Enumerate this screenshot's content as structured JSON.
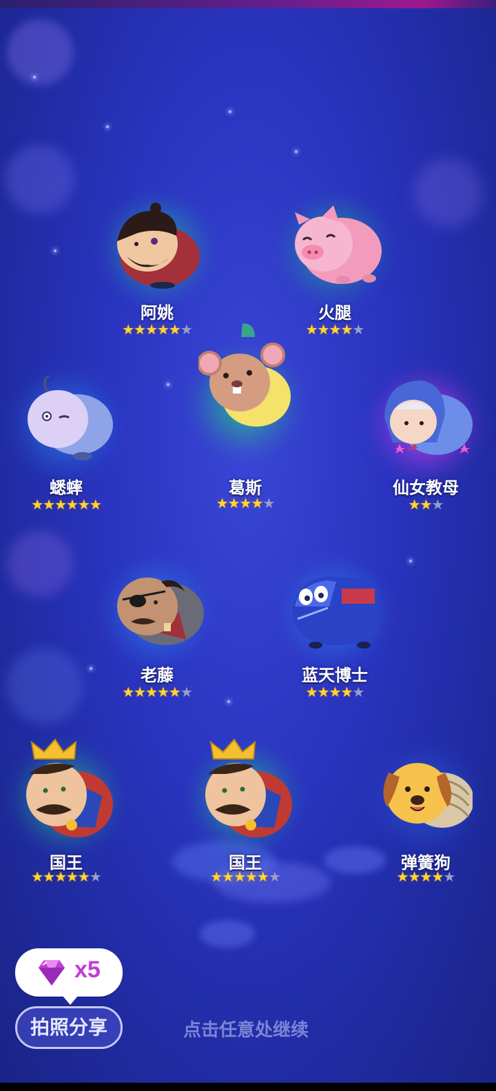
{
  "characters": [
    {
      "name": "阿姚",
      "stars_on": "★★★★★",
      "stars_off": "★",
      "glow": "#22c39a",
      "body": "#a4303a",
      "face": "#f0c7a1"
    },
    {
      "name": "火腿",
      "stars_on": "★★★★",
      "stars_off": "★",
      "glow": "#22b58a",
      "body": "#f39bbd",
      "face": "#f7b6cf"
    },
    {
      "name": "蟋蟀",
      "stars_on": "★★★★★★",
      "stars_off": "",
      "glow": "#2b88f0",
      "body": "#8fa4e8",
      "face": "#dcd0f6"
    },
    {
      "name": "葛斯",
      "stars_on": "★★★★",
      "stars_off": "★",
      "glow": "#27d27f",
      "body": "#f4e26a",
      "face": "#d49c80"
    },
    {
      "name": "仙女教母",
      "stars_on": "★★",
      "stars_off": "★",
      "glow": "#d23ef0",
      "body": "#4768d6",
      "face": "#f6d6c5"
    },
    {
      "name": "老藤",
      "stars_on": "★★★★★",
      "stars_off": "★",
      "glow": "#2b8cf0",
      "body": "#6b6b78",
      "face": "#c39272"
    },
    {
      "name": "蓝天博士",
      "stars_on": "★★★★",
      "stars_off": "★",
      "glow": "#2b8cf0",
      "body": "#2a43c6",
      "face": "#2a43c6"
    },
    {
      "name": "国王",
      "stars_on": "★★★★★",
      "stars_off": "★",
      "glow": "#27c98a",
      "body": "#c03a34",
      "face": "#eec39e"
    },
    {
      "name": "国王",
      "stars_on": "★★★★★",
      "stars_off": "★",
      "glow": "#27c98a",
      "body": "#c03a34",
      "face": "#eec39e"
    },
    {
      "name": "弹簧狗",
      "stars_on": "★★★★",
      "stars_off": "★",
      "glow": "#2a5ad8",
      "body": "#f0a83a",
      "face": "#f6c24c"
    }
  ],
  "reward": {
    "count": "x5",
    "icon": "gem-icon",
    "color": "#c43ad8"
  },
  "share_button": "拍照分享",
  "continue_hint": "点击任意处继续"
}
